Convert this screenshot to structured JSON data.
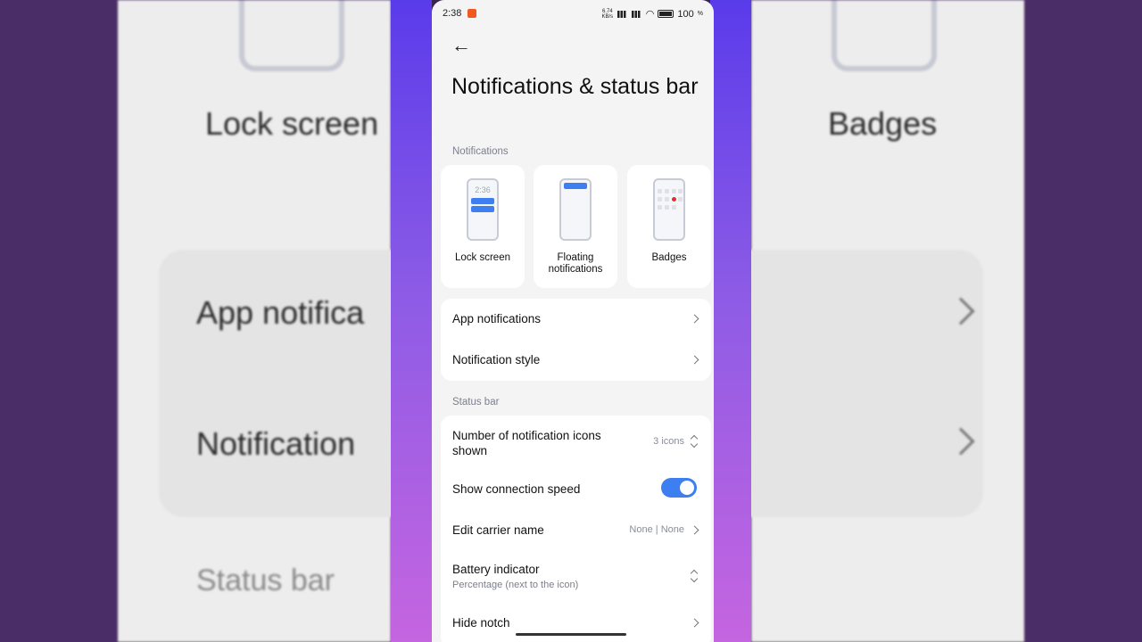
{
  "background": {
    "left_items": [
      "Lock screen",
      "App notifica",
      "Notification",
      "Status bar"
    ],
    "right_items": [
      "Badges"
    ]
  },
  "status_bar": {
    "time": "2:38",
    "net_speed": "6.74 KB/s",
    "battery": "100"
  },
  "header": {
    "back_icon": "arrow-left-icon",
    "title": "Notifications & status bar"
  },
  "notifications": {
    "section_label": "Notifications",
    "tiles": [
      {
        "label": "Lock screen",
        "preview_time": "2:36"
      },
      {
        "label": "Floating notifications"
      },
      {
        "label": "Badges"
      }
    ],
    "rows": [
      {
        "label": "App notifications"
      },
      {
        "label": "Notification style"
      }
    ]
  },
  "status_section": {
    "section_label": "Status bar",
    "rows": [
      {
        "label": "Number of notification icons shown",
        "value": "3 icons"
      },
      {
        "label": "Show connection speed",
        "toggle": true
      },
      {
        "label": "Edit carrier name",
        "value": "None | None"
      },
      {
        "label": "Battery indicator",
        "sublabel": "Percentage (next to the icon)"
      },
      {
        "label": "Hide notch"
      }
    ]
  },
  "colors": {
    "accent": "#3d7ff0",
    "badge_dot": "#e0302a",
    "recording": "#f05a22"
  }
}
